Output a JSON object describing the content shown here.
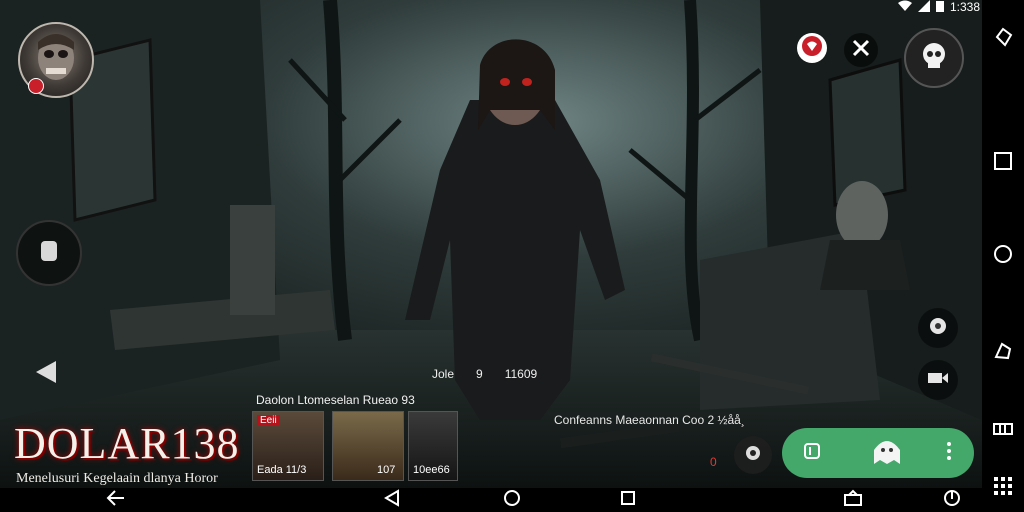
{
  "status_bar": {
    "time": "1:338"
  },
  "brand": {
    "title": "DOLAR138",
    "tagline": "Menelusuri Kegelaain dlanya Horor"
  },
  "strip": {
    "title": "Daolon  Ltomeselan Rueao  93",
    "thumbs": [
      {
        "tag": "Eeii",
        "caption": "Eada      11/3"
      },
      {
        "tag": "",
        "caption": "107"
      },
      {
        "tag": "",
        "caption": "10ee66"
      }
    ]
  },
  "mid_info": {
    "a": "Jole",
    "b": "9",
    "c": "11609"
  },
  "sub_info": "Confeanns Maeaonnan Coo 2 ½åå¸",
  "indicator": "0",
  "icons": {
    "top": [
      "heart-badge-icon",
      "swords-icon",
      "skull-icon"
    ],
    "right": [
      "gear-icon",
      "video-camera-icon"
    ],
    "pill": [
      "card-icon",
      "ghost-icon",
      "more-icon"
    ],
    "left": [
      "tile-icon",
      "back-triangle-icon"
    ],
    "rail": [
      "pin-icon",
      "square-icon",
      "circle-icon",
      "gesture-icon",
      "battery-icon",
      "grid-icon"
    ],
    "nav": [
      "back-arrow-icon",
      "back-icon",
      "home-icon",
      "recents-icon",
      "share-icon",
      "power-icon"
    ]
  },
  "colors": {
    "accent_green": "#43a86a",
    "accent_red": "#c81f2a",
    "brand_glow": "#b00000"
  }
}
